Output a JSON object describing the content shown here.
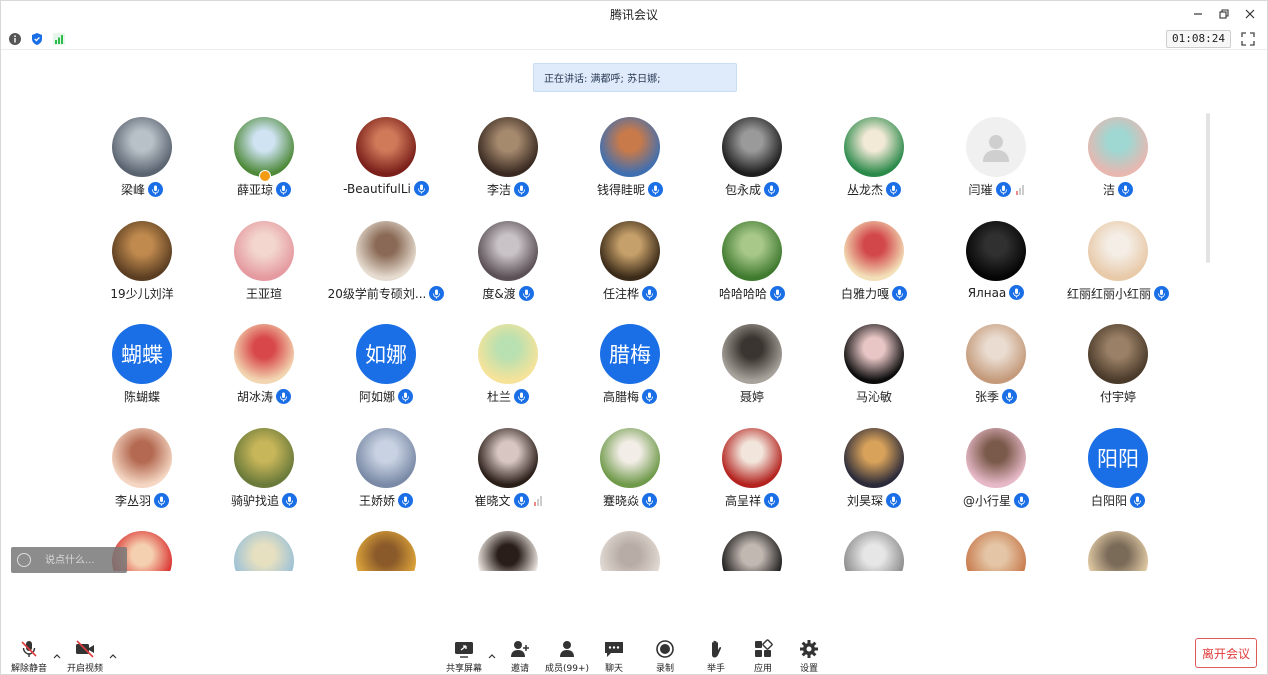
{
  "window": {
    "title": "腾讯会议",
    "timer": "01:08:24"
  },
  "speaking": {
    "text": "正在讲话: 满都呼; 苏日娜;"
  },
  "chat": {
    "placeholder": "说点什么..."
  },
  "participants": [
    {
      "name": "梁峰",
      "mic": true,
      "avatar": {
        "type": "photo",
        "colors": [
          "#5a6470",
          "#b9c1c8"
        ]
      }
    },
    {
      "name": "薛亚琼",
      "mic": true,
      "host": true,
      "avatar": {
        "type": "photo",
        "colors": [
          "#4e8a3a",
          "#cfe3f2"
        ]
      }
    },
    {
      "name": "-BeautifulLi",
      "mic": true,
      "avatar": {
        "type": "photo",
        "colors": [
          "#7a1f1a",
          "#d07a5a"
        ]
      }
    },
    {
      "name": "李洁",
      "mic": true,
      "avatar": {
        "type": "photo",
        "colors": [
          "#3a2a22",
          "#a68a6e"
        ]
      }
    },
    {
      "name": "钱得眭昵",
      "mic": true,
      "avatar": {
        "type": "photo",
        "colors": [
          "#3f6fb0",
          "#c97a4a"
        ]
      }
    },
    {
      "name": "包永成",
      "mic": true,
      "avatar": {
        "type": "photo",
        "colors": [
          "#1e1e1e",
          "#9a9a9a"
        ]
      }
    },
    {
      "name": "丛龙杰",
      "mic": true,
      "avatar": {
        "type": "photo",
        "colors": [
          "#2a8a4a",
          "#f2e9d6"
        ]
      }
    },
    {
      "name": "闫璀",
      "mic": true,
      "signal": true,
      "avatar": {
        "type": "placeholder",
        "colors": [
          "#e4e4e4",
          "#f4f4f4"
        ]
      }
    },
    {
      "name": "洁",
      "mic": true,
      "avatar": {
        "type": "photo",
        "colors": [
          "#e7b7b0",
          "#9fd7d2"
        ]
      }
    },
    {
      "name": "19少儿刘洋",
      "mic": false,
      "avatar": {
        "type": "photo",
        "colors": [
          "#5b3e22",
          "#c08a4e"
        ]
      }
    },
    {
      "name": "王亚瑄",
      "mic": false,
      "avatar": {
        "type": "photo",
        "colors": [
          "#e59aa0",
          "#f3d7cf"
        ]
      }
    },
    {
      "name": "20级学前专硕刘...",
      "mic": true,
      "avatar": {
        "type": "photo",
        "colors": [
          "#e6dcd0",
          "#8a6a56"
        ]
      }
    },
    {
      "name": "度&渡",
      "mic": true,
      "avatar": {
        "type": "photo",
        "colors": [
          "#5a5055",
          "#c9c2c6"
        ]
      }
    },
    {
      "name": "任注桦",
      "mic": true,
      "avatar": {
        "type": "photo",
        "colors": [
          "#3a2a18",
          "#c6a06a"
        ]
      }
    },
    {
      "name": "哈哈哈哈",
      "mic": true,
      "avatar": {
        "type": "photo",
        "colors": [
          "#3f7a2f",
          "#a8c88a"
        ]
      }
    },
    {
      "name": "白雅力嘎",
      "mic": true,
      "avatar": {
        "type": "photo",
        "colors": [
          "#f3e0b8",
          "#d2484a"
        ]
      }
    },
    {
      "name": "Ялнаа",
      "mic": true,
      "avatar": {
        "type": "photo",
        "colors": [
          "#050505",
          "#303030"
        ]
      }
    },
    {
      "name": "红丽红丽小红丽",
      "mic": true,
      "avatar": {
        "type": "photo",
        "colors": [
          "#e8c9a8",
          "#f4eee6"
        ]
      }
    },
    {
      "name": "陈蝴蝶",
      "mic": false,
      "avatar": {
        "type": "text",
        "label": "蝴蝶"
      }
    },
    {
      "name": "胡冰涛",
      "mic": true,
      "avatar": {
        "type": "photo",
        "colors": [
          "#f2d6b2",
          "#d8484a"
        ]
      }
    },
    {
      "name": "阿如娜",
      "mic": true,
      "avatar": {
        "type": "text",
        "label": "如娜"
      }
    },
    {
      "name": "杜兰",
      "mic": true,
      "avatar": {
        "type": "photo",
        "colors": [
          "#f6e39a",
          "#b9e0b0"
        ]
      }
    },
    {
      "name": "高腊梅",
      "mic": true,
      "avatar": {
        "type": "text",
        "label": "腊梅"
      }
    },
    {
      "name": "聂婷",
      "mic": false,
      "avatar": {
        "type": "photo",
        "colors": [
          "#a8a29c",
          "#3a3530"
        ]
      }
    },
    {
      "name": "马沁敏",
      "mic": false,
      "avatar": {
        "type": "photo",
        "colors": [
          "#0c0c0c",
          "#e8c6c6"
        ]
      }
    },
    {
      "name": "张季",
      "mic": true,
      "avatar": {
        "type": "photo",
        "colors": [
          "#c49a7a",
          "#eadcd0"
        ]
      }
    },
    {
      "name": "付宇婷",
      "mic": false,
      "avatar": {
        "type": "photo",
        "colors": [
          "#4a3a2a",
          "#9a8066"
        ]
      }
    },
    {
      "name": "李丛羽",
      "mic": true,
      "avatar": {
        "type": "photo",
        "colors": [
          "#f4d6c2",
          "#b46a52"
        ]
      }
    },
    {
      "name": "骑驴找追",
      "mic": true,
      "avatar": {
        "type": "photo",
        "colors": [
          "#6a7a3a",
          "#c8b65a"
        ]
      }
    },
    {
      "name": "王娇娇",
      "mic": true,
      "avatar": {
        "type": "photo",
        "colors": [
          "#7a8aa6",
          "#c8d2e2"
        ]
      }
    },
    {
      "name": "崔晓文",
      "mic": true,
      "signal": true,
      "avatar": {
        "type": "photo",
        "colors": [
          "#2a1e18",
          "#d8c6c2"
        ]
      }
    },
    {
      "name": "蹇晓焱",
      "mic": true,
      "avatar": {
        "type": "photo",
        "colors": [
          "#6f9a4a",
          "#f2ede6"
        ]
      }
    },
    {
      "name": "高呈祥",
      "mic": true,
      "avatar": {
        "type": "photo",
        "colors": [
          "#b3221e",
          "#f2e6dc"
        ]
      }
    },
    {
      "name": "刘昊琛",
      "mic": true,
      "avatar": {
        "type": "photo",
        "colors": [
          "#2a2a3a",
          "#d8a25a"
        ]
      }
    },
    {
      "name": "@小行星",
      "mic": true,
      "avatar": {
        "type": "photo",
        "colors": [
          "#e7b9c8",
          "#7a5a4a"
        ]
      }
    },
    {
      "name": "白阳阳",
      "mic": true,
      "avatar": {
        "type": "text",
        "label": "阳阳"
      }
    },
    {
      "name": "",
      "mic": false,
      "avatar": {
        "type": "photo",
        "colors": [
          "#d82a2a",
          "#f5d0b0"
        ]
      }
    },
    {
      "name": "",
      "mic": false,
      "avatar": {
        "type": "photo",
        "colors": [
          "#9ac0d8",
          "#e6e0c0"
        ]
      }
    },
    {
      "name": "",
      "mic": false,
      "avatar": {
        "type": "photo",
        "colors": [
          "#e2a83a",
          "#8a5a2a"
        ]
      }
    },
    {
      "name": "",
      "mic": false,
      "avatar": {
        "type": "photo",
        "colors": [
          "#f6f0ea",
          "#2a1e1a"
        ]
      }
    },
    {
      "name": "",
      "mic": false,
      "avatar": {
        "type": "photo",
        "colors": [
          "#e4dcd6",
          "#b8aca6"
        ]
      }
    },
    {
      "name": "",
      "mic": false,
      "avatar": {
        "type": "photo",
        "colors": [
          "#181818",
          "#c2b8b2"
        ]
      }
    },
    {
      "name": "",
      "mic": false,
      "avatar": {
        "type": "photo",
        "colors": [
          "#8a8a8a",
          "#e6e6e6"
        ]
      }
    },
    {
      "name": "",
      "mic": false,
      "avatar": {
        "type": "photo",
        "colors": [
          "#c8784a",
          "#e4c6a6"
        ]
      }
    },
    {
      "name": "",
      "mic": false,
      "avatar": {
        "type": "photo",
        "colors": [
          "#e6cfa8",
          "#7a6a58"
        ]
      }
    }
  ],
  "toolbar": {
    "unmute": "解除静音",
    "start_video": "开启视频",
    "share_screen": "共享屏幕",
    "invite": "邀请",
    "members": "成员(99+)",
    "chat": "聊天",
    "record": "录制",
    "raise_hand": "举手",
    "apps": "应用",
    "settings": "设置",
    "leave": "离开会议"
  },
  "colors": {
    "accent": "#1a6fe6",
    "leave": "#e03c3c",
    "speaking_bg": "#dfeafb"
  }
}
